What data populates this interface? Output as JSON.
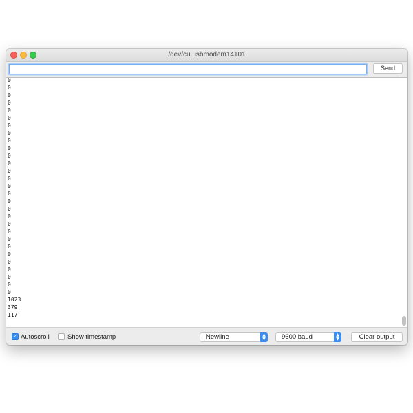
{
  "window": {
    "title": "/dev/cu.usbmodem14101"
  },
  "input": {
    "value": "",
    "placeholder": ""
  },
  "buttons": {
    "send": "Send",
    "clear_output": "Clear output"
  },
  "output": {
    "lines": [
      "0",
      "0",
      "0",
      "0",
      "0",
      "0",
      "0",
      "0",
      "0",
      "0",
      "0",
      "0",
      "0",
      "0",
      "0",
      "0",
      "0",
      "0",
      "0",
      "0",
      "0",
      "0",
      "0",
      "0",
      "0",
      "0",
      "0",
      "0",
      "0",
      "1023",
      "379",
      "117"
    ]
  },
  "options": {
    "autoscroll": {
      "label": "Autoscroll",
      "checked": true
    },
    "timestamp": {
      "label": "Show timestamp",
      "checked": false
    },
    "line_ending": {
      "selected": "Newline"
    },
    "baud_rate": {
      "selected": "9600 baud"
    }
  },
  "colors": {
    "accent": "#3b8cf0",
    "close": "#fc605c",
    "minimize": "#fdbc40",
    "maximize": "#34c84a"
  },
  "icons": {
    "checkmark": "checkmark-icon",
    "stepper": "chevron-up-down-icon"
  }
}
